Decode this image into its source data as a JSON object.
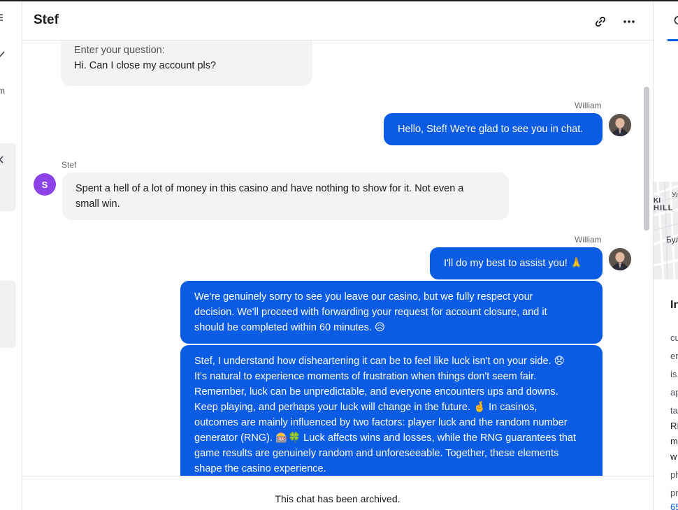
{
  "window": {
    "chat_title": "Stef"
  },
  "left_strip": {
    "partial_text": "m"
  },
  "chat": {
    "messages": [
      {
        "author": "",
        "direction": "in",
        "label": "Enter your question:",
        "text": "Hi. Can I close my account pls?"
      },
      {
        "author": "William",
        "direction": "out",
        "text": "Hello, Stef! We're glad to see you in chat."
      },
      {
        "author": "Stef",
        "avatar_letter": "S",
        "direction": "in",
        "lines": [
          "Spent a hell of a lot of money in this casino and have nothing to show for it. Not even a",
          "small win."
        ]
      },
      {
        "author": "William",
        "direction": "out",
        "text": "I'll do my best to assist you! 🙏"
      },
      {
        "author": "",
        "direction": "out",
        "lines": [
          "We're genuinely sorry to see you leave our casino, but we fully respect your",
          "decision. We'll proceed with forwarding your request for account closure, and it",
          "should be completed within 60 minutes. 😥"
        ]
      },
      {
        "author": "",
        "direction": "out",
        "lines": [
          "Stef, I understand how disheartening it can be to feel like luck isn't on your side. 😞",
          "It's natural to experience moments of frustration when things don't seem fair.",
          "Remember, luck can be unpredictable, and everyone encounters ups and downs.",
          "Keep playing, and perhaps your luck will change in the future. 🤞 In casinos,",
          "outcomes are mainly influenced by two factors: player luck and the random number",
          "generator (RNG). 🎰🍀 Luck affects wins and losses, while the RNG guarantees that",
          "game results are genuinely random and unforeseeable. Together, these elements",
          "shape the casino experience."
        ]
      }
    ],
    "archived_notice": "This chat has been archived."
  },
  "right_panel": {
    "map_labels": [
      "Ул",
      "KI",
      "HILL",
      "Бул"
    ],
    "section_heading": "In",
    "info_fragments": [
      "cu",
      "er",
      "is,",
      "ap",
      "ta",
      "RI",
      "m",
      "w",
      "ph",
      "pr",
      "65"
    ]
  },
  "colors": {
    "accent": "#0b5ce5",
    "incoming_bubble": "#f3f3f4",
    "avatar_letter_bg": "#8b44e8"
  },
  "icons": {
    "link": "link-icon",
    "more": "more-horizontal-icon",
    "pencil": "pencil-icon",
    "close": "close-icon",
    "search": "search-icon"
  }
}
